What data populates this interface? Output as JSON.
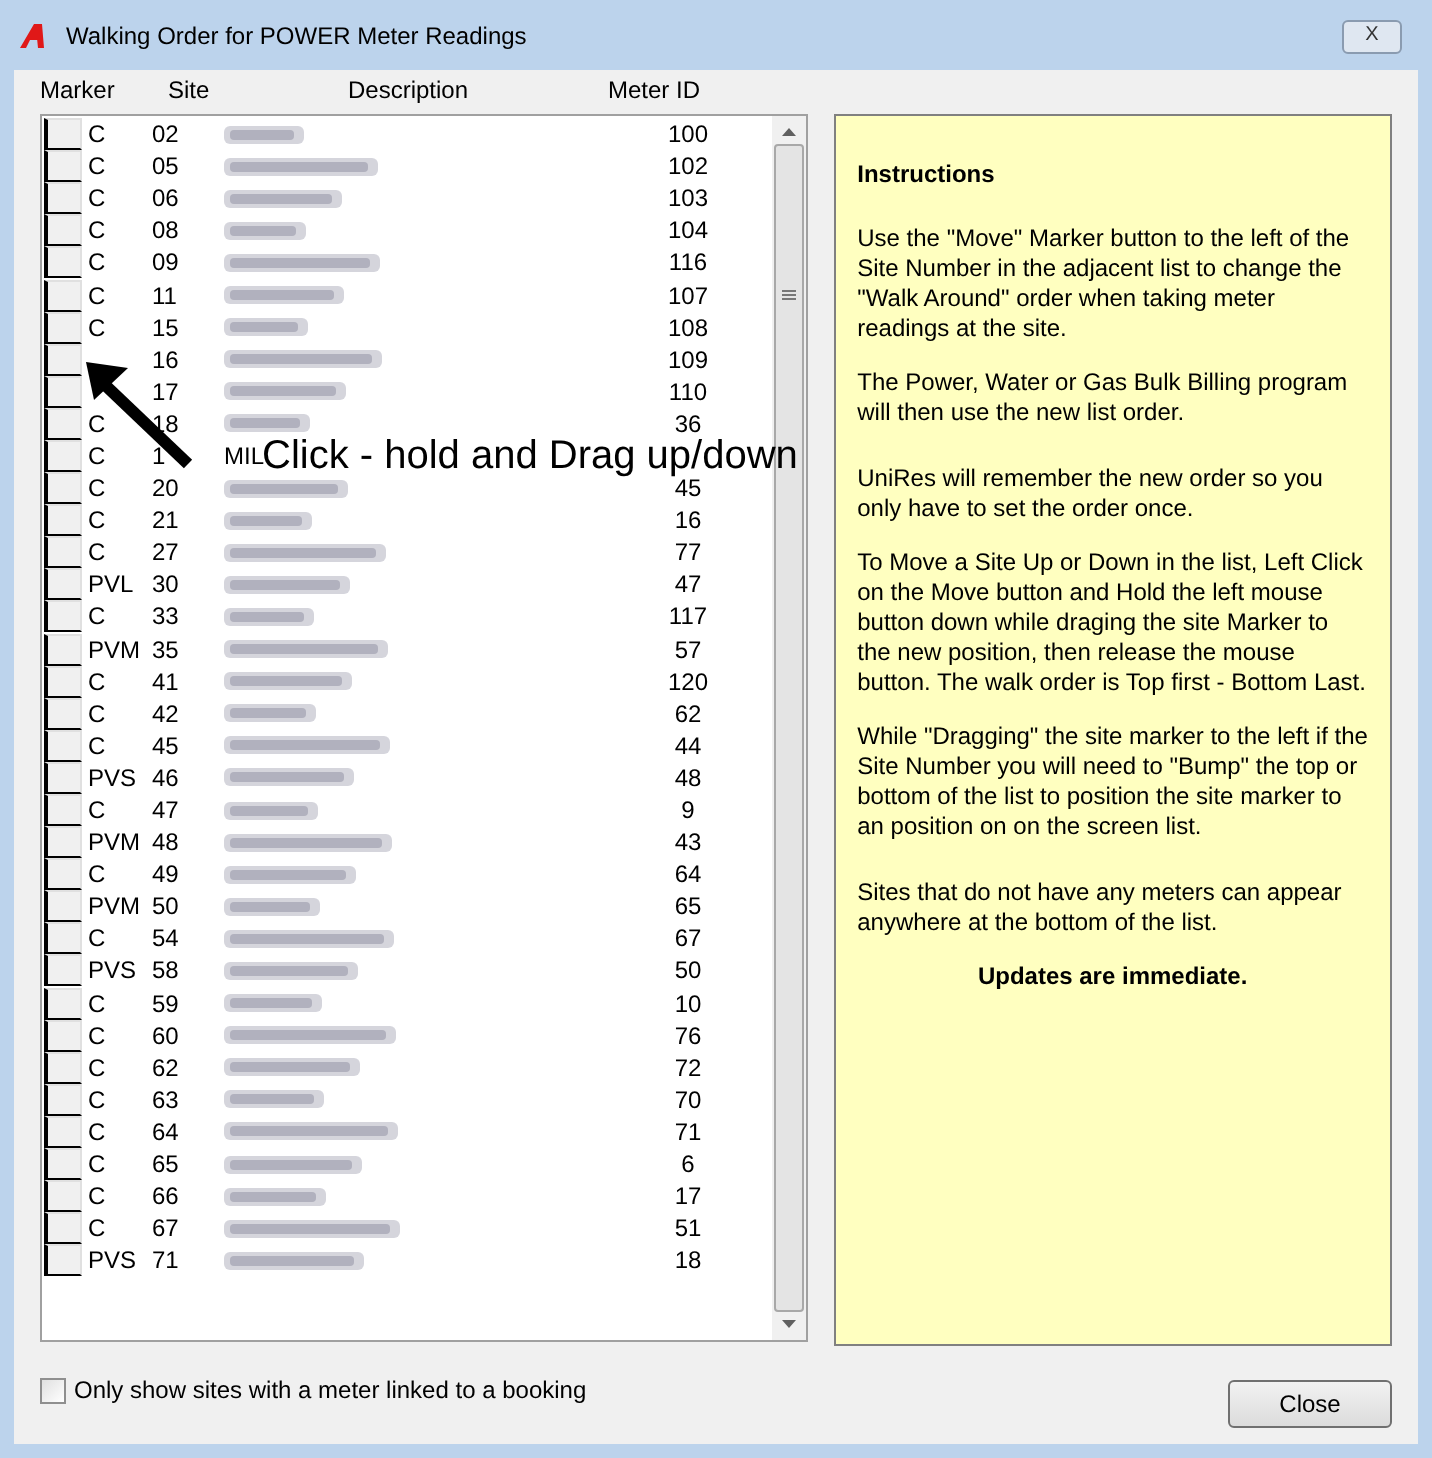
{
  "window": {
    "title": "Walking Order for POWER Meter Readings",
    "close": "X"
  },
  "list": {
    "columns": [
      "Marker",
      "Site",
      "Description",
      "Meter ID"
    ],
    "rows": [
      {
        "status": "C",
        "site": "02",
        "meter_id": "100"
      },
      {
        "status": "C",
        "site": "05",
        "meter_id": "102"
      },
      {
        "status": "C",
        "site": "06",
        "meter_id": "103"
      },
      {
        "status": "C",
        "site": "08",
        "meter_id": "104"
      },
      {
        "status": "C",
        "site": "09",
        "meter_id": "116"
      },
      {
        "status": "C",
        "site": "11",
        "meter_id": "107"
      },
      {
        "status": "C",
        "site": "15",
        "meter_id": "108"
      },
      {
        "site": "16",
        "meter_id": "109"
      },
      {
        "site": "17",
        "meter_id": "110"
      },
      {
        "status": "C",
        "site": "18",
        "meter_id": "36"
      },
      {
        "status": "C",
        "site": "1",
        "description": "MIL"
      },
      {
        "status": "C",
        "site": "20",
        "meter_id": "45"
      },
      {
        "status": "C",
        "site": "21",
        "meter_id": "16"
      },
      {
        "status": "C",
        "site": "27",
        "meter_id": "77"
      },
      {
        "status": "PVL",
        "site": "30",
        "meter_id": "47"
      },
      {
        "status": "C",
        "site": "33",
        "meter_id": "117"
      },
      {
        "status": "PVM",
        "site": "35",
        "meter_id": "57"
      },
      {
        "status": "C",
        "site": "41",
        "meter_id": "120"
      },
      {
        "status": "C",
        "site": "42",
        "meter_id": "62"
      },
      {
        "status": "C",
        "site": "45",
        "meter_id": "44"
      },
      {
        "status": "PVS",
        "site": "46",
        "meter_id": "48"
      },
      {
        "status": "C",
        "site": "47",
        "meter_id": "9"
      },
      {
        "status": "PVM",
        "site": "48",
        "meter_id": "43"
      },
      {
        "status": "C",
        "site": "49",
        "meter_id": "64"
      },
      {
        "status": "PVM",
        "site": "50",
        "meter_id": "65"
      },
      {
        "status": "C",
        "site": "54",
        "meter_id": "67"
      },
      {
        "status": "PVS",
        "site": "58",
        "meter_id": "50"
      },
      {
        "status": "C",
        "site": "59",
        "meter_id": "10"
      },
      {
        "status": "C",
        "site": "60",
        "meter_id": "76"
      },
      {
        "status": "C",
        "site": "62",
        "meter_id": "72"
      },
      {
        "status": "C",
        "site": "63",
        "meter_id": "70"
      },
      {
        "status": "C",
        "site": "64",
        "meter_id": "71"
      },
      {
        "status": "C",
        "site": "65",
        "meter_id": "6"
      },
      {
        "status": "C",
        "site": "66",
        "meter_id": "17"
      },
      {
        "status": "C",
        "site": "67",
        "meter_id": "51"
      },
      {
        "status": "PVS",
        "site": "71",
        "meter_id": "18"
      }
    ]
  },
  "annotation": {
    "text": "Click - hold and Drag up/down"
  },
  "instructions": {
    "title": "Instructions",
    "paragraphs": [
      "Use the \"Move\" Marker button to the left of the Site Number in the adjacent list to change the \"Walk Around\" order when taking meter readings at the site.",
      "The Power, Water or Gas Bulk Billing program will then use the new list order.",
      "UniRes will remember the new order so you only have to set the order once.",
      "To Move a Site Up or Down in the list, Left Click on the Move button and Hold the left mouse button down while draging the site Marker to the new position, then release the mouse button. The walk order is Top first - Bottom Last.",
      "While \"Dragging\" the site marker to the left if the Site Number you will need to \"Bump\" the top or bottom of the list to position the site marker to an position on on the screen list.",
      "Sites that do not have any meters can appear anywhere at the bottom of the list."
    ],
    "footer": "Updates are immediate."
  },
  "filter": {
    "label": "Only show sites with a meter linked to a booking",
    "checked": false
  },
  "buttons": [
    "Close"
  ]
}
